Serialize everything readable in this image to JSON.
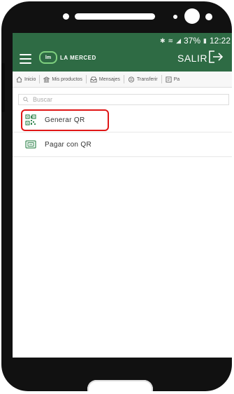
{
  "status_bar": {
    "battery": "37%",
    "time": "12:22"
  },
  "header": {
    "logo_mark": "lm",
    "logo_text": "LA MERCED",
    "logout_label": "SALIR"
  },
  "nav": {
    "items": [
      {
        "label": "Inicio",
        "icon": "home-icon"
      },
      {
        "label": "Mis productos",
        "icon": "bank-icon"
      },
      {
        "label": "Mensajes",
        "icon": "inbox-icon"
      },
      {
        "label": "Transferir",
        "icon": "transfer-icon"
      },
      {
        "label": "Pa",
        "icon": "payments-icon"
      }
    ]
  },
  "search": {
    "placeholder": "Buscar"
  },
  "menu": {
    "items": [
      {
        "label": "Generar QR",
        "icon": "qr-code-icon",
        "highlighted": true
      },
      {
        "label": "Pagar con QR",
        "icon": "qr-scan-icon",
        "highlighted": false
      }
    ]
  },
  "colors": {
    "header_bg": "#2e6b44",
    "highlight": "#e01616"
  }
}
